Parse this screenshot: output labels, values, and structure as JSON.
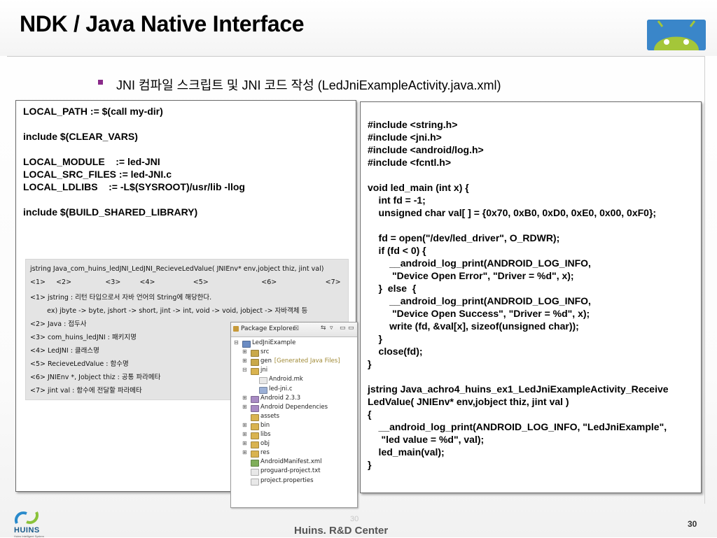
{
  "slide": {
    "title": "NDK / Java Native Interface",
    "subtitle": "JNI 컴파일 스크립트 및 JNI 코드 작성 (LedJniExampleActivity.java.xml)",
    "footer": "Huins. R&D Center",
    "page_number": "30",
    "ghost_page_number": "30",
    "brand_name": "HUINS",
    "brand_tagline": "Huins Intelligent System",
    "accent_color": "#8a2a8a"
  },
  "android_mk": {
    "lines": [
      "LOCAL_PATH := $(call my-dir)",
      "",
      "include $(CLEAR_VARS)",
      "",
      "LOCAL_MODULE    := led-JNI",
      "LOCAL_SRC_FILES := led-JNI.c",
      "LOCAL_LDLIBS    := -L$(SYSROOT)/usr/lib -llog",
      "",
      "include $(BUILD_SHARED_LIBRARY)"
    ]
  },
  "signature": {
    "lines": [
      "jstring Java_com_huins_ledJNI_LedJNI_RecieveLedValue( JNIEnv* env,jobject thiz, jint val)",
      "<1>     <2>                <3>         <4>                  <5>                         <6>                       <7>",
      "<1> jstring : 리턴 타입으로서 자바 언어의 String에 해당한다.",
      "        ex) jbyte -> byte, jshort -> short, jint -> int, void -> void, jobject -> 자바객체 등",
      "<2> Java : 접두사",
      "<3> com_huins_ledJNI : 패키지명",
      "<4> LedJNI : 클래스명",
      "<5> RecieveLedValue : 함수명",
      "<6> JNIEnv *, Jobject thiz : 공통 파라메타",
      "<7> jint val : 함수에 전달할 파라메타"
    ]
  },
  "package_explorer": {
    "title": "Package Explorer",
    "close_glyph": "☒",
    "toolbar": [
      "▭",
      "⇆",
      "▿",
      "▭",
      "▭"
    ],
    "items": [
      {
        "twisty": "⊟",
        "label": "LedJniExample",
        "decor": "",
        "icon": "#6b8cc4"
      },
      {
        "twisty": "⊞",
        "label": "src",
        "decor": "",
        "icon": "#c9a94a"
      },
      {
        "twisty": "⊞",
        "label": "gen",
        "decor": "[Generated Java Files]",
        "icon": "#c9a94a"
      },
      {
        "twisty": "⊟",
        "label": "jni",
        "decor": "",
        "icon": "#d9b34f"
      },
      {
        "twisty": "",
        "label": "Android.mk",
        "decor": "",
        "icon": "#e8e8e8"
      },
      {
        "twisty": "",
        "label": "led-jni.c",
        "decor": "",
        "icon": "#9bb0d6"
      },
      {
        "twisty": "⊞",
        "label": "Android 2.3.3",
        "decor": "",
        "icon": "#a88bc4"
      },
      {
        "twisty": "⊞",
        "label": "Android Dependencies",
        "decor": "",
        "icon": "#a88bc4"
      },
      {
        "twisty": "",
        "label": "assets",
        "decor": "",
        "icon": "#d9b34f"
      },
      {
        "twisty": "⊞",
        "label": "bin",
        "decor": "",
        "icon": "#d9b34f"
      },
      {
        "twisty": "⊞",
        "label": "libs",
        "decor": "",
        "icon": "#d9b34f"
      },
      {
        "twisty": "⊞",
        "label": "obj",
        "decor": "",
        "icon": "#d9b34f"
      },
      {
        "twisty": "⊞",
        "label": "res",
        "decor": "",
        "icon": "#d9b34f"
      },
      {
        "twisty": "",
        "label": "AndroidManifest.xml",
        "decor": "",
        "icon": "#7fae5a"
      },
      {
        "twisty": "",
        "label": "proguard-project.txt",
        "decor": "",
        "icon": "#e8e8e8"
      },
      {
        "twisty": "",
        "label": "project.properties",
        "decor": "",
        "icon": "#e8e8e8"
      }
    ]
  },
  "c_source": {
    "lines": [
      "#include <string.h>",
      "#include <jni.h>",
      "#include <android/log.h>",
      "#include <fcntl.h>",
      "",
      "void led_main (int x) {",
      "    int fd = -1;",
      "    unsigned char val[ ] = {0x70, 0xB0, 0xD0, 0xE0, 0x00, 0xF0};",
      "",
      "    fd = open(\"/dev/led_driver\", O_RDWR);",
      "    if (fd < 0) {",
      "        __android_log_print(ANDROID_LOG_INFO,",
      "         \"Device Open Error\", \"Driver = %d\", x);",
      "    }  else  {",
      "        __android_log_print(ANDROID_LOG_INFO,",
      "         \"Device Open Success\", \"Driver = %d\", x);",
      "        write (fd, &val[x], sizeof(unsigned char));",
      "    }",
      "    close(fd);",
      "}",
      "",
      "jstring Java_achro4_huins_ex1_LedJniExampleActivity_Receive",
      "LedValue( JNIEnv* env,jobject thiz, jint val )",
      "{",
      "    __android_log_print(ANDROID_LOG_INFO, \"LedJniExample\",",
      "     \"led value = %d\", val);",
      "    led_main(val);",
      "}"
    ]
  }
}
